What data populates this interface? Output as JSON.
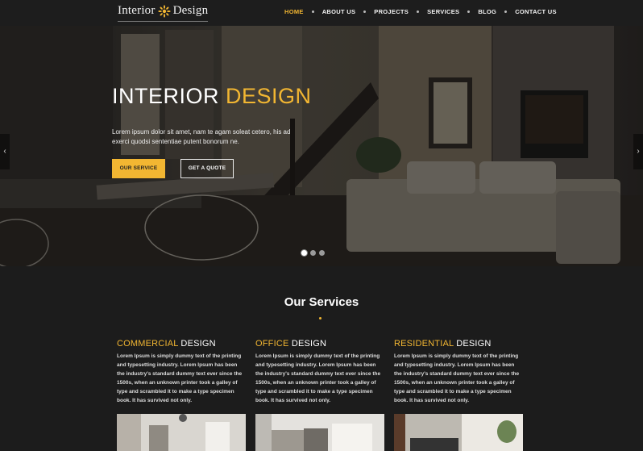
{
  "logo": {
    "word1": "Interior",
    "word2": "Design",
    "icon": "sun-flower-icon"
  },
  "nav": {
    "items": [
      {
        "label": "HOME",
        "active": true
      },
      {
        "label": "ABOUT US",
        "active": false
      },
      {
        "label": "PROJECTS",
        "active": false
      },
      {
        "label": "SERVICES",
        "active": false
      },
      {
        "label": "BLOG",
        "active": false
      },
      {
        "label": "CONTACT US",
        "active": false
      }
    ]
  },
  "hero": {
    "title_main": "INTERIOR",
    "title_accent": "DESIGN",
    "text": "Lorem ipsum dolor sit amet, nam te agam soleat cetero, his ad exerci quodsi sententiae putent bonorum ne.",
    "primary_button": "OUR SERVICE",
    "secondary_button": "GET A QUOTE",
    "prev_icon": "chevron-left-icon",
    "next_icon": "chevron-right-icon",
    "slides_total": 3,
    "slide_active": 1
  },
  "services": {
    "title": "Our Services",
    "items": [
      {
        "accent": "COMMERCIAL",
        "rest": "DESIGN",
        "text": "Lorem Ipsum is simply dummy text of the printing and typesetting industry. Lorem Ipsum has been the industry's standard dummy text ever since the 1500s, when an unknown printer took a galley of type and scrambled it to make a type specimen book. It has survived not only."
      },
      {
        "accent": "OFFICE",
        "rest": "DESIGN",
        "text": "Lorem Ipsum is simply dummy text of the printing and typesetting industry. Lorem Ipsum has been the industry's standard dummy text ever since the 1500s, when an unknown printer took a galley of type and scrambled it to make a type specimen book. It has survived not only."
      },
      {
        "accent": "RESIDENTIAL",
        "rest": "DESIGN",
        "text": "Lorem Ipsum is simply dummy text of the printing and typesetting industry. Lorem Ipsum has been the industry's standard dummy text ever since the 1500s, when an unknown printer took a galley of type and scrambled it to make a type specimen book. It has survived not only."
      }
    ]
  },
  "colors": {
    "accent": "#f2b632",
    "background": "#1c1c1c"
  }
}
